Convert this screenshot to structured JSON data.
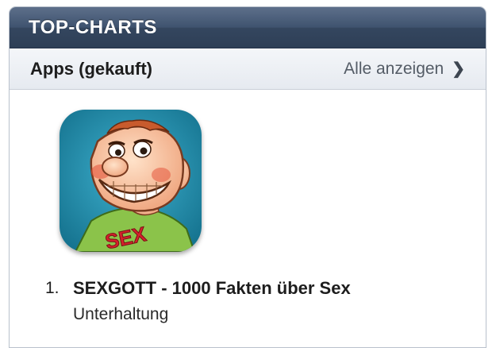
{
  "header": {
    "title": "TOP-CHARTS"
  },
  "section": {
    "title": "Apps (gekauft)",
    "see_all_label": "Alle anzeigen",
    "see_all_icon": "chevron-right-icon"
  },
  "apps": [
    {
      "rank": "1.",
      "name": "SEXGOTT - 1000 Fakten über Sex",
      "category": "Unterhaltung",
      "icon_label": "SEX"
    }
  ],
  "colors": {
    "header_bg": "#34465f",
    "icon_bg": "#1e8aa8",
    "shirt": "#8bc34a"
  }
}
